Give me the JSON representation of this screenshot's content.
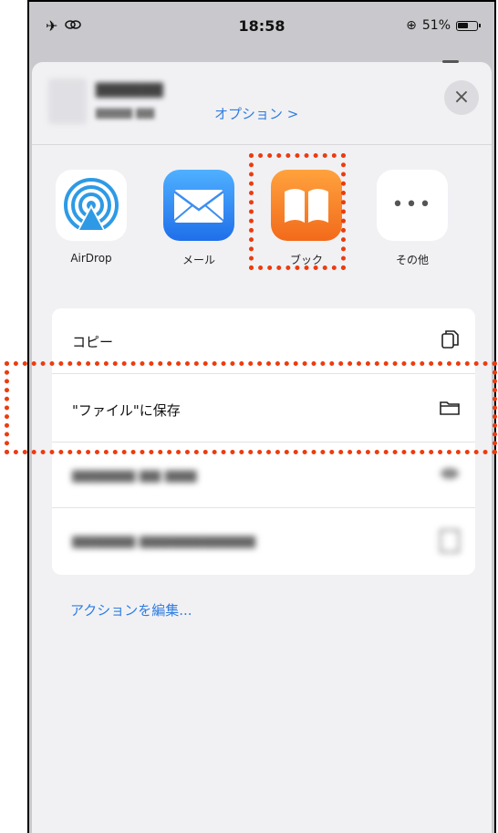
{
  "statusbar": {
    "time": "18:58",
    "battery": "51%",
    "left_icons": [
      "airplane-icon",
      "link-icon"
    ]
  },
  "share_sheet": {
    "options_link": "オプション >",
    "close_label": "×"
  },
  "apps": [
    {
      "label": "AirDrop",
      "icon": "airdrop-icon"
    },
    {
      "label": "メール",
      "icon": "mail-icon"
    },
    {
      "label": "ブック",
      "icon": "books-icon"
    },
    {
      "label": "その他",
      "icon": "more-icon"
    }
  ],
  "actions": [
    {
      "label": "コピー",
      "icon": "copy-icon"
    },
    {
      "label": "\"ファイル\"に保存",
      "icon": "folder-icon"
    }
  ],
  "edit_actions_label": "アクションを編集...",
  "colors": {
    "highlight": "#ec3c0e",
    "link": "#2f7de1"
  }
}
